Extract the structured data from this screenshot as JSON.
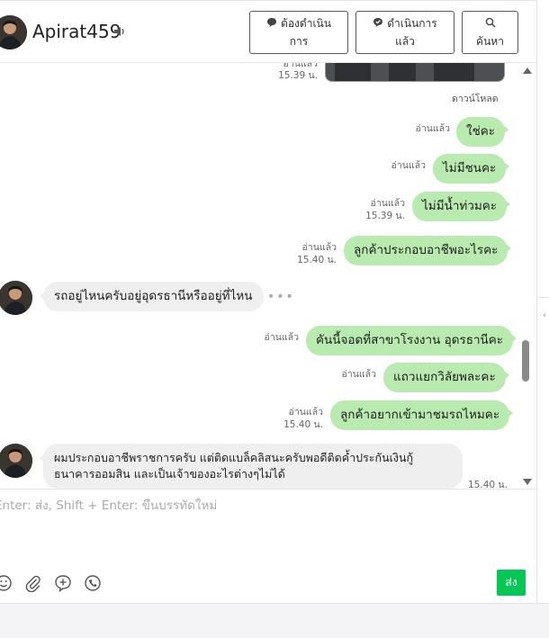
{
  "header": {
    "contact_name": "Apirat459",
    "buttons": {
      "todo_line1": "ต้องดำเนิน",
      "todo_line2": "การ",
      "done_line1": "ดำเนินการ",
      "done_line2": "แล้ว",
      "search": "ค้นหา"
    }
  },
  "chat": {
    "top": {
      "read_label": "อ่านแล้ว",
      "time": "15.39 น.",
      "download_label": "ดาวน์โหลด"
    },
    "messages": [
      {
        "direction": "out",
        "text": "ใช่คะ",
        "read": "อ่านแล้ว",
        "time": ""
      },
      {
        "direction": "out",
        "text": "ไม่มีชนคะ",
        "read": "อ่านแล้ว",
        "time": ""
      },
      {
        "direction": "out",
        "text": "ไม่มีน้ำท่วมคะ",
        "read": "อ่านแล้ว",
        "time": "15.39 น."
      },
      {
        "direction": "out",
        "text": "ลูกค้าประกอบอาชีพอะไรคะ",
        "read": "อ่านแล้ว",
        "time": "15.40 น."
      },
      {
        "direction": "in",
        "text": "รถอยู่ไหนครับอยู่อุดรธานีหรืออยู่ที่ไหน",
        "time": ""
      },
      {
        "direction": "out",
        "text": "คันนี้จอดที่สาขาโรงงาน อุดรธานีคะ",
        "read": "อ่านแล้ว",
        "time": ""
      },
      {
        "direction": "out",
        "text": "แถวแยกวิลัยพละคะ",
        "read": "อ่านแล้ว",
        "time": ""
      },
      {
        "direction": "out",
        "text": "ลูกค้าอยากเข้ามาชมรถไหมคะ",
        "read": "อ่านแล้ว",
        "time": "15.40 น."
      },
      {
        "direction": "in",
        "text_line1": "ผมประกอบอาชีพราชการครับ แต่ติดแบล็คลิสนะครับพอดีติดค้ำประกันเงินกู้",
        "text_line2": "ธนาคารออมสิน และเป็นเจ้าของอะไรต่างๆไม่ได้",
        "time": "15.40 น."
      }
    ]
  },
  "composer": {
    "placeholder": "Enter: ส่ง, Shift + Enter: ขึ้นบรรทัดใหม่",
    "send_label": "ส่ง"
  },
  "colors": {
    "outgoing_bubble": "#b9eaaf",
    "incoming_bubble": "#efefef",
    "send_button": "#06c755"
  }
}
